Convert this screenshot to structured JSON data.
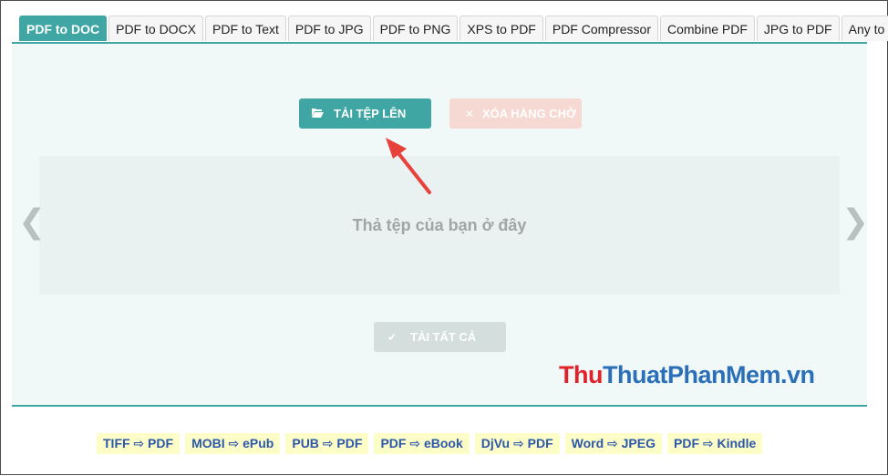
{
  "tabs": [
    {
      "label": "PDF to DOC",
      "active": true
    },
    {
      "label": "PDF to DOCX"
    },
    {
      "label": "PDF to Text"
    },
    {
      "label": "PDF to JPG"
    },
    {
      "label": "PDF to PNG"
    },
    {
      "label": "XPS to PDF"
    },
    {
      "label": "PDF Compressor"
    },
    {
      "label": "Combine PDF"
    },
    {
      "label": "JPG to PDF"
    },
    {
      "label": "Any to PDF"
    }
  ],
  "buttons": {
    "upload": {
      "label": "TẢI TỆP LÊN",
      "icon": "folder-open-icon"
    },
    "clear": {
      "label": "XÓA HÀNG CHỜ",
      "icon": "close-icon"
    },
    "download_all": {
      "label": "TẢI TẤT CẢ",
      "icon": "check-icon"
    }
  },
  "dropzone": {
    "text": "Thả tệp của bạn ở đây"
  },
  "carousel": {
    "prev": "❮",
    "next": "❯"
  },
  "watermark": {
    "part1": "Thu",
    "part2": "Thuat",
    "part3": "PhanMem.vn"
  },
  "bottom_links": [
    "TIFF ⇨ PDF",
    "MOBI ⇨ ePub",
    "PUB ⇨ PDF",
    "PDF ⇨ eBook",
    "DjVu ⇨ PDF",
    "Word ⇨ JPEG",
    "PDF ⇨ Kindle"
  ],
  "colors": {
    "accent": "#3fa6a3",
    "arrow": "#e8403a",
    "link_bg": "#fdfdc8"
  }
}
